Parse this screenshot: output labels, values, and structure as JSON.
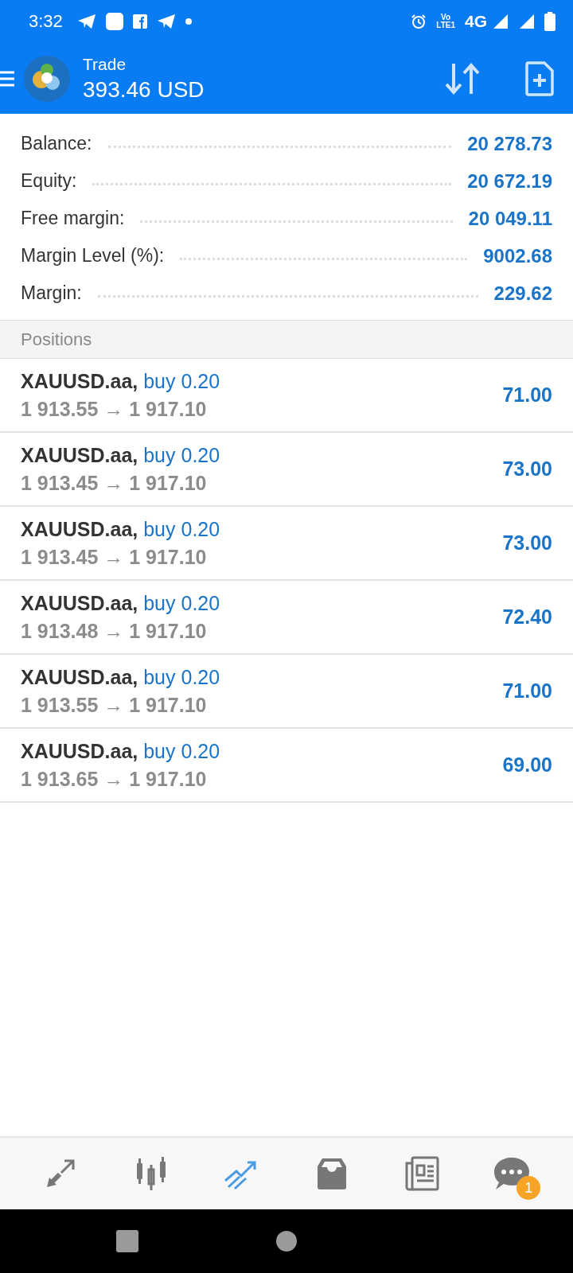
{
  "status_bar": {
    "time": "3:32",
    "volte": [
      "Vo",
      "LTE1"
    ],
    "network": "4G"
  },
  "header": {
    "title": "Trade",
    "profit": "393.46 USD"
  },
  "summary": [
    {
      "label": "Balance:",
      "value": "20 278.73"
    },
    {
      "label": "Equity:",
      "value": "20 672.19"
    },
    {
      "label": "Free margin:",
      "value": "20 049.11"
    },
    {
      "label": "Margin Level (%):",
      "value": "9002.68"
    },
    {
      "label": "Margin:",
      "value": "229.62"
    }
  ],
  "positions": {
    "title": "Positions",
    "rows": [
      {
        "symbol": "XAUUSD.aa,",
        "side": "buy 0.20",
        "prices": "1 913.55 → 1 917.10",
        "profit": "71.00"
      },
      {
        "symbol": "XAUUSD.aa,",
        "side": "buy 0.20",
        "prices": "1 913.45 → 1 917.10",
        "profit": "73.00"
      },
      {
        "symbol": "XAUUSD.aa,",
        "side": "buy 0.20",
        "prices": "1 913.45 → 1 917.10",
        "profit": "73.00"
      },
      {
        "symbol": "XAUUSD.aa,",
        "side": "buy 0.20",
        "prices": "1 913.48 → 1 917.10",
        "profit": "72.40"
      },
      {
        "symbol": "XAUUSD.aa,",
        "side": "buy 0.20",
        "prices": "1 913.55 → 1 917.10",
        "profit": "71.00"
      },
      {
        "symbol": "XAUUSD.aa,",
        "side": "buy 0.20",
        "prices": "1 913.65 → 1 917.10",
        "profit": "69.00"
      }
    ]
  },
  "bottom_nav": [
    {
      "kind": "quotes",
      "selected": false
    },
    {
      "kind": "chart",
      "selected": false
    },
    {
      "kind": "trade",
      "selected": true
    },
    {
      "kind": "history",
      "selected": false
    },
    {
      "kind": "news",
      "selected": false
    },
    {
      "kind": "chat",
      "selected": false,
      "badge": "1"
    }
  ]
}
